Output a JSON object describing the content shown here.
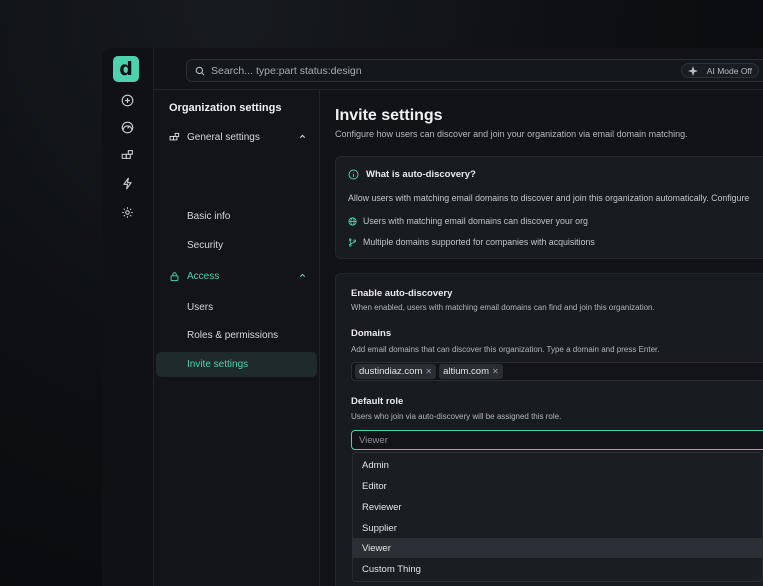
{
  "app": {
    "logo_letter": "d",
    "brand_color": "#4fd1b0"
  },
  "rail": {
    "icons": [
      "plus-circle-icon",
      "dashboard-icon",
      "blocks-icon",
      "lightning-icon",
      "gear-icon"
    ]
  },
  "search": {
    "placeholder": "Search... type:part status:design",
    "ai_mode_label": "AI Mode Off"
  },
  "sidebar": {
    "title": "Organization settings",
    "groups": [
      {
        "label": "General settings",
        "icon": "blocks-icon",
        "expanded": true,
        "items": [
          {
            "label": "Basic info"
          },
          {
            "label": "Security"
          }
        ]
      },
      {
        "label": "Access",
        "icon": "lock-icon",
        "expanded": true,
        "items": [
          {
            "label": "Users"
          },
          {
            "label": "Roles & permissions"
          },
          {
            "label": "Invite settings",
            "active": true
          }
        ]
      }
    ]
  },
  "main": {
    "title": "Invite settings",
    "subtitle": "Configure how users can discover and join your organization via email domain matching.",
    "info_card": {
      "heading": "What is auto-discovery?",
      "description": "Allow users with matching email domains to discover and join this organization automatically. Configure",
      "features": [
        {
          "icon": "globe-icon",
          "text": "Users with matching email domains can discover your org"
        },
        {
          "icon": "branch-icon",
          "text": "Multiple domains supported for companies with acquisitions"
        }
      ]
    },
    "auto_discovery": {
      "heading": "Enable auto-discovery",
      "description": "When enabled, users with matching email domains can find and join this organization.",
      "domains_label": "Domains",
      "domains_hint": "Add email domains that can discover this organization. Type a domain and press Enter.",
      "domains": [
        "dustindiaz.com",
        "altium.com"
      ],
      "role_label": "Default role",
      "role_hint": "Users who join via auto-discovery will be assigned this role.",
      "role_value": "Viewer",
      "role_options": [
        "Admin",
        "Editor",
        "Reviewer",
        "Supplier",
        "Viewer",
        "Custom Thing"
      ],
      "role_selected": "Viewer"
    }
  }
}
